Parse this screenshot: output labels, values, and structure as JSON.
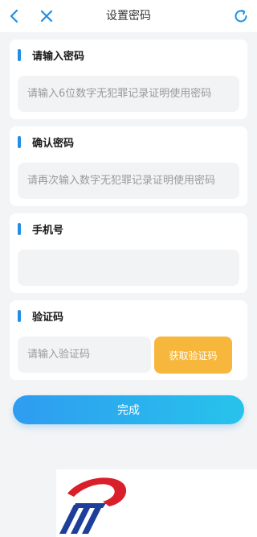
{
  "header": {
    "title": "设置密码",
    "back_icon": "chevron-left-icon",
    "close_icon": "close-icon",
    "refresh_icon": "refresh-icon",
    "icon_color": "#1f8fe6"
  },
  "form": {
    "password": {
      "label": "请输入密码",
      "value": "",
      "placeholder": "请输入6位数字无犯罪记录证明使用密码"
    },
    "confirm": {
      "label": "确认密码",
      "value": "",
      "placeholder": "请再次输入数字无犯罪记录证明使用密码"
    },
    "phone": {
      "label": "手机号",
      "value": "",
      "placeholder": ""
    },
    "code": {
      "label": "验证码",
      "value": "",
      "placeholder": "请输入验证码",
      "button_label": "获取验证码",
      "button_color": "#f6b73c"
    }
  },
  "submit": {
    "label": "完成",
    "gradient_start": "#2f9cf0",
    "gradient_end": "#27c3ec"
  },
  "colors": {
    "accent": "#1f8fe6",
    "background": "#f3f4f6",
    "card": "#ffffff",
    "logo_red": "#d9202a",
    "logo_blue": "#1d3f9a"
  },
  "logo": {
    "icon": "police-badge-logo"
  }
}
